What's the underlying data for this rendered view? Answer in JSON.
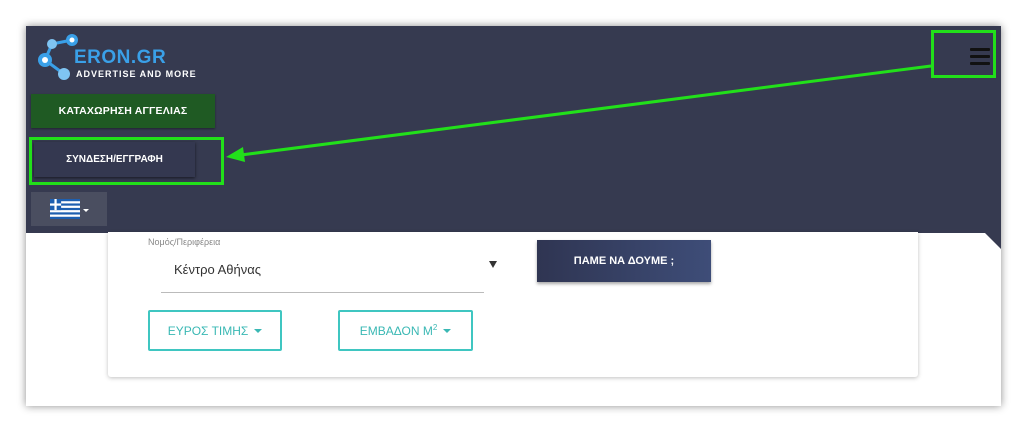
{
  "logo": {
    "brand": "ERON.GR",
    "tagline": "ADVERTISE AND MORE"
  },
  "nav": {
    "post_ad_label": "ΚΑΤΑΧΩΡΗΣΗ ΑΓΓΕΛΙΑΣ",
    "login_label": "ΣΥΝΔΕΣΗ/ΕΓΓΡΑΦΗ",
    "language": "Greek flag"
  },
  "search": {
    "region_label": "Νομός/Περιφέρεια",
    "region_value": "Κέντρο Αθήνας",
    "go_label": "ΠΑΜΕ ΝΑ ΔΟΥΜΕ ;",
    "price_label": "ΕΥΡΟΣ ΤΙΜΗΣ",
    "area_label": "ΕΜΒΑΔΟΝ Μ",
    "area_sup": "2"
  },
  "colors": {
    "navbar": "#363a50",
    "post_ad_green": "#1f5a23",
    "highlight_green": "#22e01a",
    "teal_outline": "#3fc6c1"
  }
}
